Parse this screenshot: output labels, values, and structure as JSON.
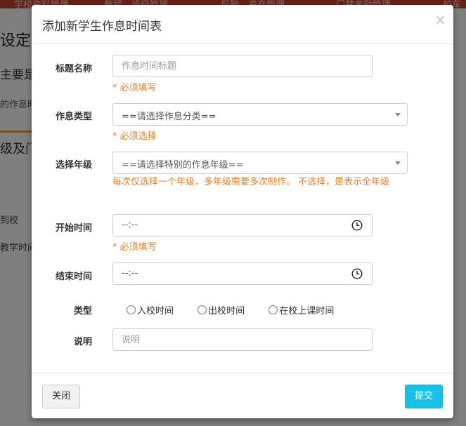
{
  "background": {
    "nav_items": [
      "学校资料管理",
      "教师、班级管理",
      "后勤、资产管理",
      "门禁考勤管理",
      "校车"
    ],
    "heading": "设定管",
    "line1": "主要是",
    "line2": "的作息时",
    "subheading": "级及门",
    "item1": "到校",
    "item2": "教学时间"
  },
  "modal": {
    "title": "添加新学生作息时间表",
    "close_glyph": "×",
    "fields": {
      "title": {
        "label": "标题名称",
        "placeholder": "作息时间标题",
        "hint": "* 必须填写"
      },
      "category": {
        "label": "作息类型",
        "selected": "==请选择作息分类==",
        "hint": "* 必须选择"
      },
      "grade": {
        "label": "选择年级",
        "selected": "==请选择特别的作息年级==",
        "hint": "每次仅选择一个年级，多年级需要多次制作。 不选择，是表示全年级"
      },
      "start_time": {
        "label": "开始时间",
        "value": "--:--",
        "hint": "* 必须填写"
      },
      "end_time": {
        "label": "结束时间",
        "value": "--:--"
      },
      "type": {
        "label": "类型",
        "options": [
          "入校时间",
          "出校时间",
          "在校上课时间"
        ]
      },
      "description": {
        "label": "说明",
        "placeholder": "说明"
      }
    },
    "footer": {
      "close_label": "关闭",
      "submit_label": "提交"
    }
  },
  "colors": {
    "accent": "#18c2e7",
    "hint": "#e67e22",
    "topbar": "#c9402c"
  },
  "icons": {
    "close": "close-icon",
    "dropdown": "chevron-down-icon",
    "clock": "clock-icon"
  }
}
